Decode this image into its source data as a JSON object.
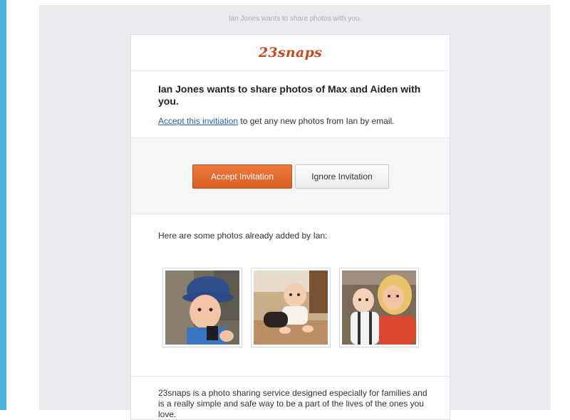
{
  "preheader": "Ian Jones wants to share photos with you.",
  "logo": "23snaps",
  "headline": "Ian Jones wants to share photos of Max and Aiden with you.",
  "invite_line": {
    "link_text": "Accept this invitiation",
    "rest_text": " to get any new photos from Ian by email."
  },
  "buttons": {
    "accept": "Accept Invitation",
    "ignore": "Ignore Invitation"
  },
  "photos_label": "Here are some photos already added by Ian:",
  "photos": [
    {
      "icon": "photo-toddler-blue-hat"
    },
    {
      "icon": "photo-baby-crawling"
    },
    {
      "icon": "photo-mother-and-baby"
    }
  ],
  "about": "23snaps is a photo sharing service designed especially for families and is a really simple and safe way to be a part of the lives of the ones you love.",
  "colors": {
    "accent": "#d95f22",
    "brand": "#c94a1f",
    "link": "#2a5db0",
    "page_strip": "#4ab3df",
    "email_bg": "#e9ebef"
  }
}
